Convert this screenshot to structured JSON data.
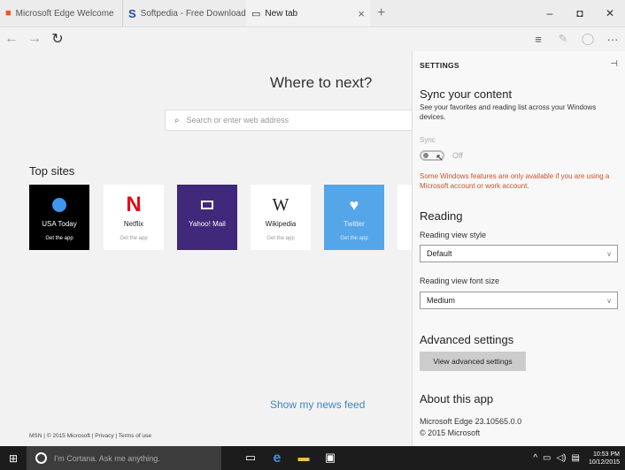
{
  "tabs": [
    {
      "label": "Microsoft Edge Welcome"
    },
    {
      "label": "Softpedia - Free Downloads"
    },
    {
      "label": "New tab"
    }
  ],
  "window": {
    "minimize": "–",
    "maximize": "◘",
    "close": "✕"
  },
  "nav": {
    "back": "←",
    "forward": "→",
    "refresh": "↻",
    "hub": "≡",
    "note": "✎",
    "share": "◯",
    "more": "···"
  },
  "newtab": {
    "heading": "Where to next?",
    "search_placeholder": "Search or enter web address",
    "topsites_title": "Top sites",
    "sites": [
      {
        "name": "USA Today",
        "sub": "Get the app"
      },
      {
        "name": "Netflix",
        "sub": "Get the app",
        "glyph": "N"
      },
      {
        "name": "Yahoo! Mail"
      },
      {
        "name": "Wikipedia",
        "sub": "Get the app",
        "glyph": "W"
      },
      {
        "name": "Twitter",
        "sub": "Get the app"
      }
    ],
    "news_link": "Show my news feed",
    "footer": "MSN | © 2015 Microsoft  | Privacy  | Terms of use"
  },
  "settings": {
    "title": "SETTINGS",
    "sync_heading": "Sync your content",
    "sync_desc": "See your favorites and reading list across your Windows devices.",
    "sync_label": "Sync",
    "sync_state": "Off",
    "sync_warning": "Some Windows features are only available if you are using a Microsoft account or work account.",
    "reading_heading": "Reading",
    "reading_style_label": "Reading view style",
    "reading_style_value": "Default",
    "reading_font_label": "Reading view font size",
    "reading_font_value": "Medium",
    "advanced_heading": "Advanced settings",
    "advanced_button": "View advanced settings",
    "about_heading": "About this app",
    "version": "Microsoft Edge 23.10565.0.0",
    "copyright": "© 2015 Microsoft"
  },
  "taskbar": {
    "cortana_placeholder": "I'm Cortana. Ask me anything.",
    "time": "10:53 PM",
    "date": "10/12/2015"
  }
}
